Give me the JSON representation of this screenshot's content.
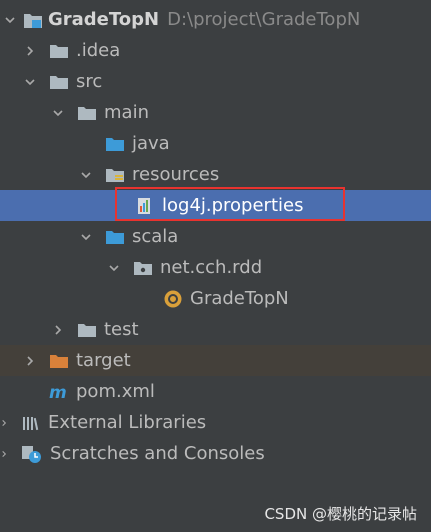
{
  "project": {
    "name": "GradeTopN",
    "path": "D:\\project\\GradeTopN"
  },
  "tree": {
    "idea": ".idea",
    "src": "src",
    "main": "main",
    "java": "java",
    "resources": "resources",
    "log4j": "log4j.properties",
    "scala": "scala",
    "package": "net.cch.rdd",
    "gradetopn_object": "GradeTopN",
    "test": "test",
    "target": "target",
    "pom": "pom.xml",
    "external_libraries": "External Libraries",
    "scratches": "Scratches and Consoles"
  },
  "colors": {
    "background": "#3c3f41",
    "selection": "#4b6eaf",
    "highlight_border": "#e8332f",
    "folder_gray": "#aeb9c0",
    "folder_blue": "#3d9bd8",
    "folder_orange": "#d9813a"
  },
  "watermark": "CSDN @樱桃的记录帖"
}
